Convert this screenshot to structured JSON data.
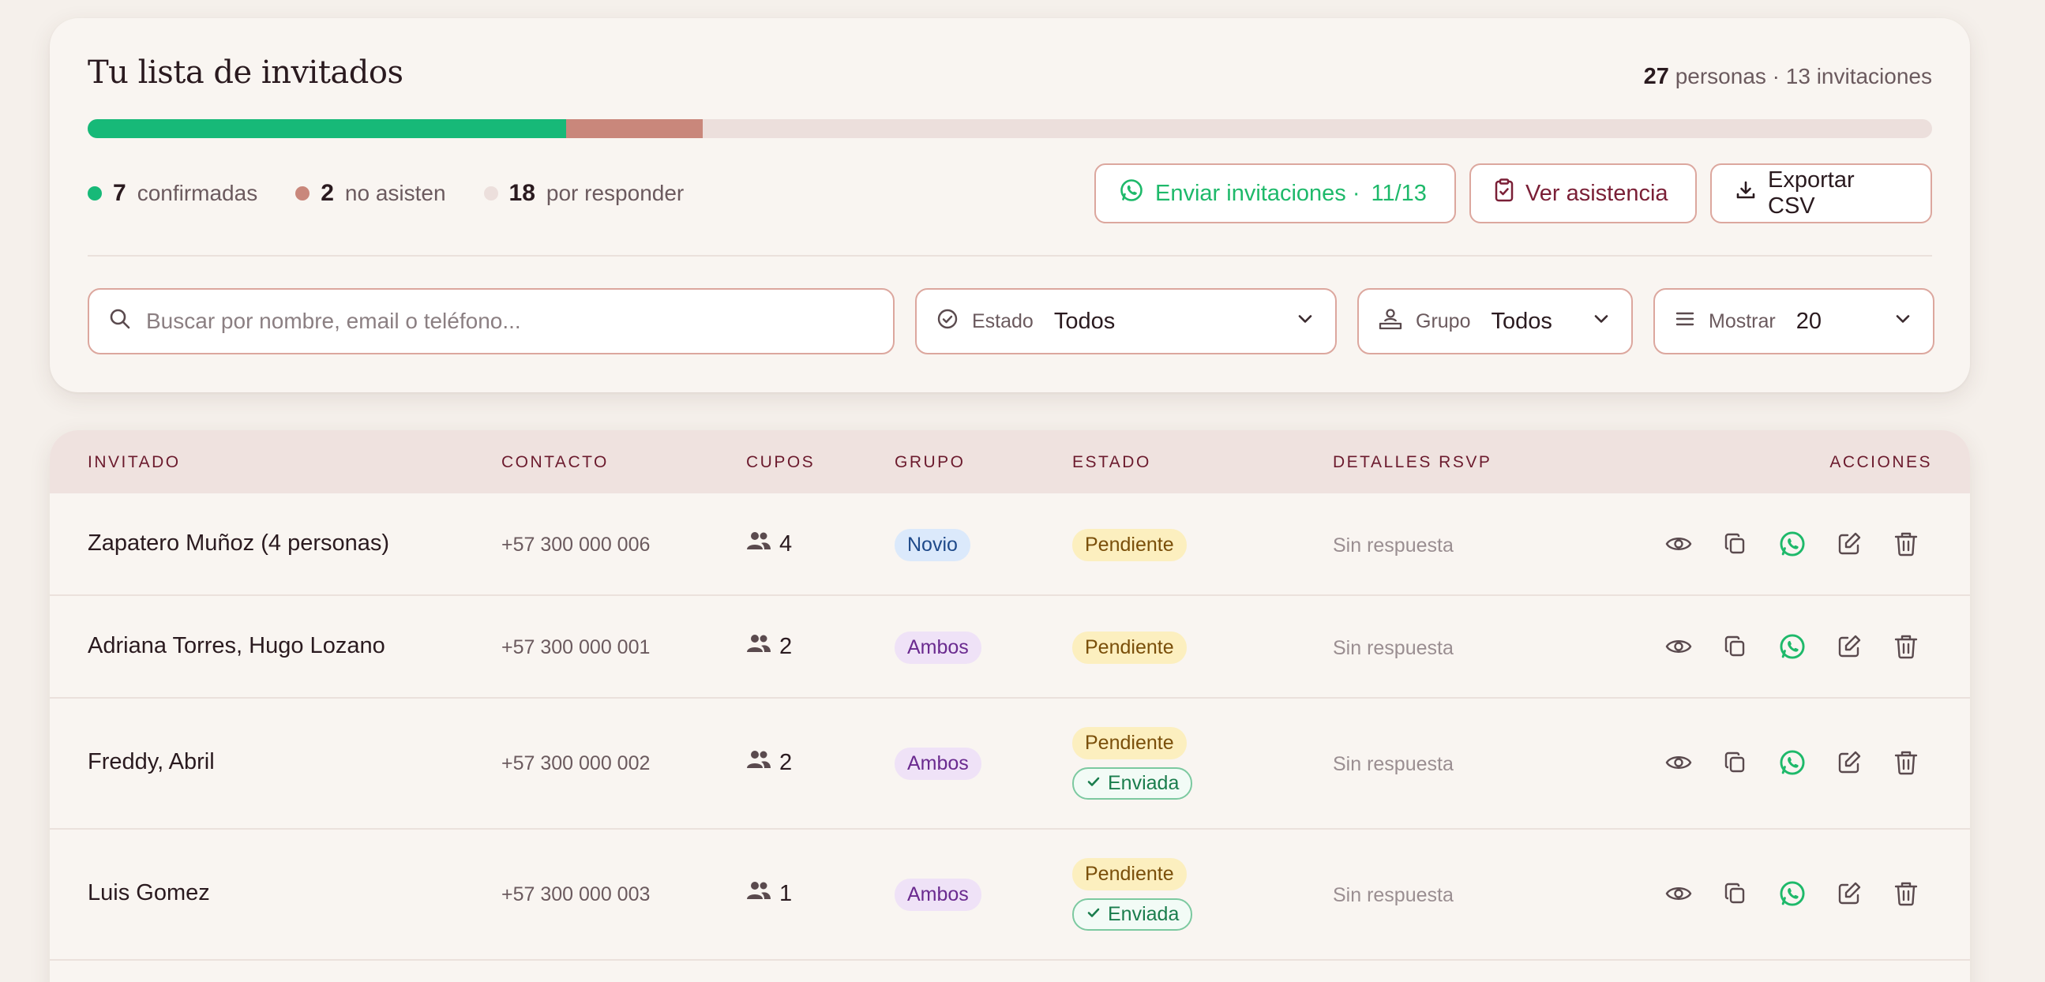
{
  "summary": {
    "title": "Tu lista de invitados",
    "total_people": "27",
    "total_people_label": "personas · 13 invitaciones",
    "confirmed_fraction": 0.2593,
    "declined_fraction": 0.0741,
    "stats": [
      {
        "count": "7",
        "label": "confirmadas",
        "color": "#17b978"
      },
      {
        "count": "2",
        "label": "no asisten",
        "color": "#c9877b"
      },
      {
        "count": "18",
        "label": "por responder",
        "color": "#ecdfdc"
      }
    ],
    "buttons": {
      "send": "Enviar invitaciones ·",
      "send_count": "11/13",
      "attendance": "Ver asistencia",
      "export": "Exportar CSV"
    }
  },
  "filters": {
    "search_placeholder": "Buscar por nombre, email o teléfono...",
    "estado_label": "Estado",
    "estado_value": "Todos",
    "grupo_label": "Grupo",
    "grupo_value": "Todos",
    "mostrar_label": "Mostrar",
    "mostrar_value": "20"
  },
  "table": {
    "headers": {
      "guest": "INVITADO",
      "contact": "CONTACTO",
      "seats": "CUPOS",
      "group": "GRUPO",
      "status": "ESTADO",
      "rsvp": "DETALLES RSVP",
      "actions": "ACCIONES"
    },
    "rows": [
      {
        "name": "Zapatero Muñoz (4 personas)",
        "phone": "+57 300 000 006",
        "seats": "4",
        "group": "Novio",
        "status": "Pendiente",
        "sent": "",
        "rsvp": "Sin respuesta"
      },
      {
        "name": "Adriana Torres, Hugo Lozano",
        "phone": "+57 300 000 001",
        "seats": "2",
        "group": "Ambos",
        "status": "Pendiente",
        "sent": "",
        "rsvp": "Sin respuesta"
      },
      {
        "name": "Freddy, Abril",
        "phone": "+57 300 000 002",
        "seats": "2",
        "group": "Ambos",
        "status": "Pendiente",
        "sent": "Enviada",
        "rsvp": "Sin respuesta"
      },
      {
        "name": "Luis Gomez",
        "phone": "+57 300 000 003",
        "seats": "1",
        "group": "Ambos",
        "status": "Pendiente",
        "sent": "Enviada",
        "rsvp": "Sin respuesta"
      }
    ]
  },
  "colors": {
    "accent": "#7a1f36",
    "whatsapp": "#1eb96a",
    "confirmed": "#17b978",
    "declined": "#c9877b"
  }
}
